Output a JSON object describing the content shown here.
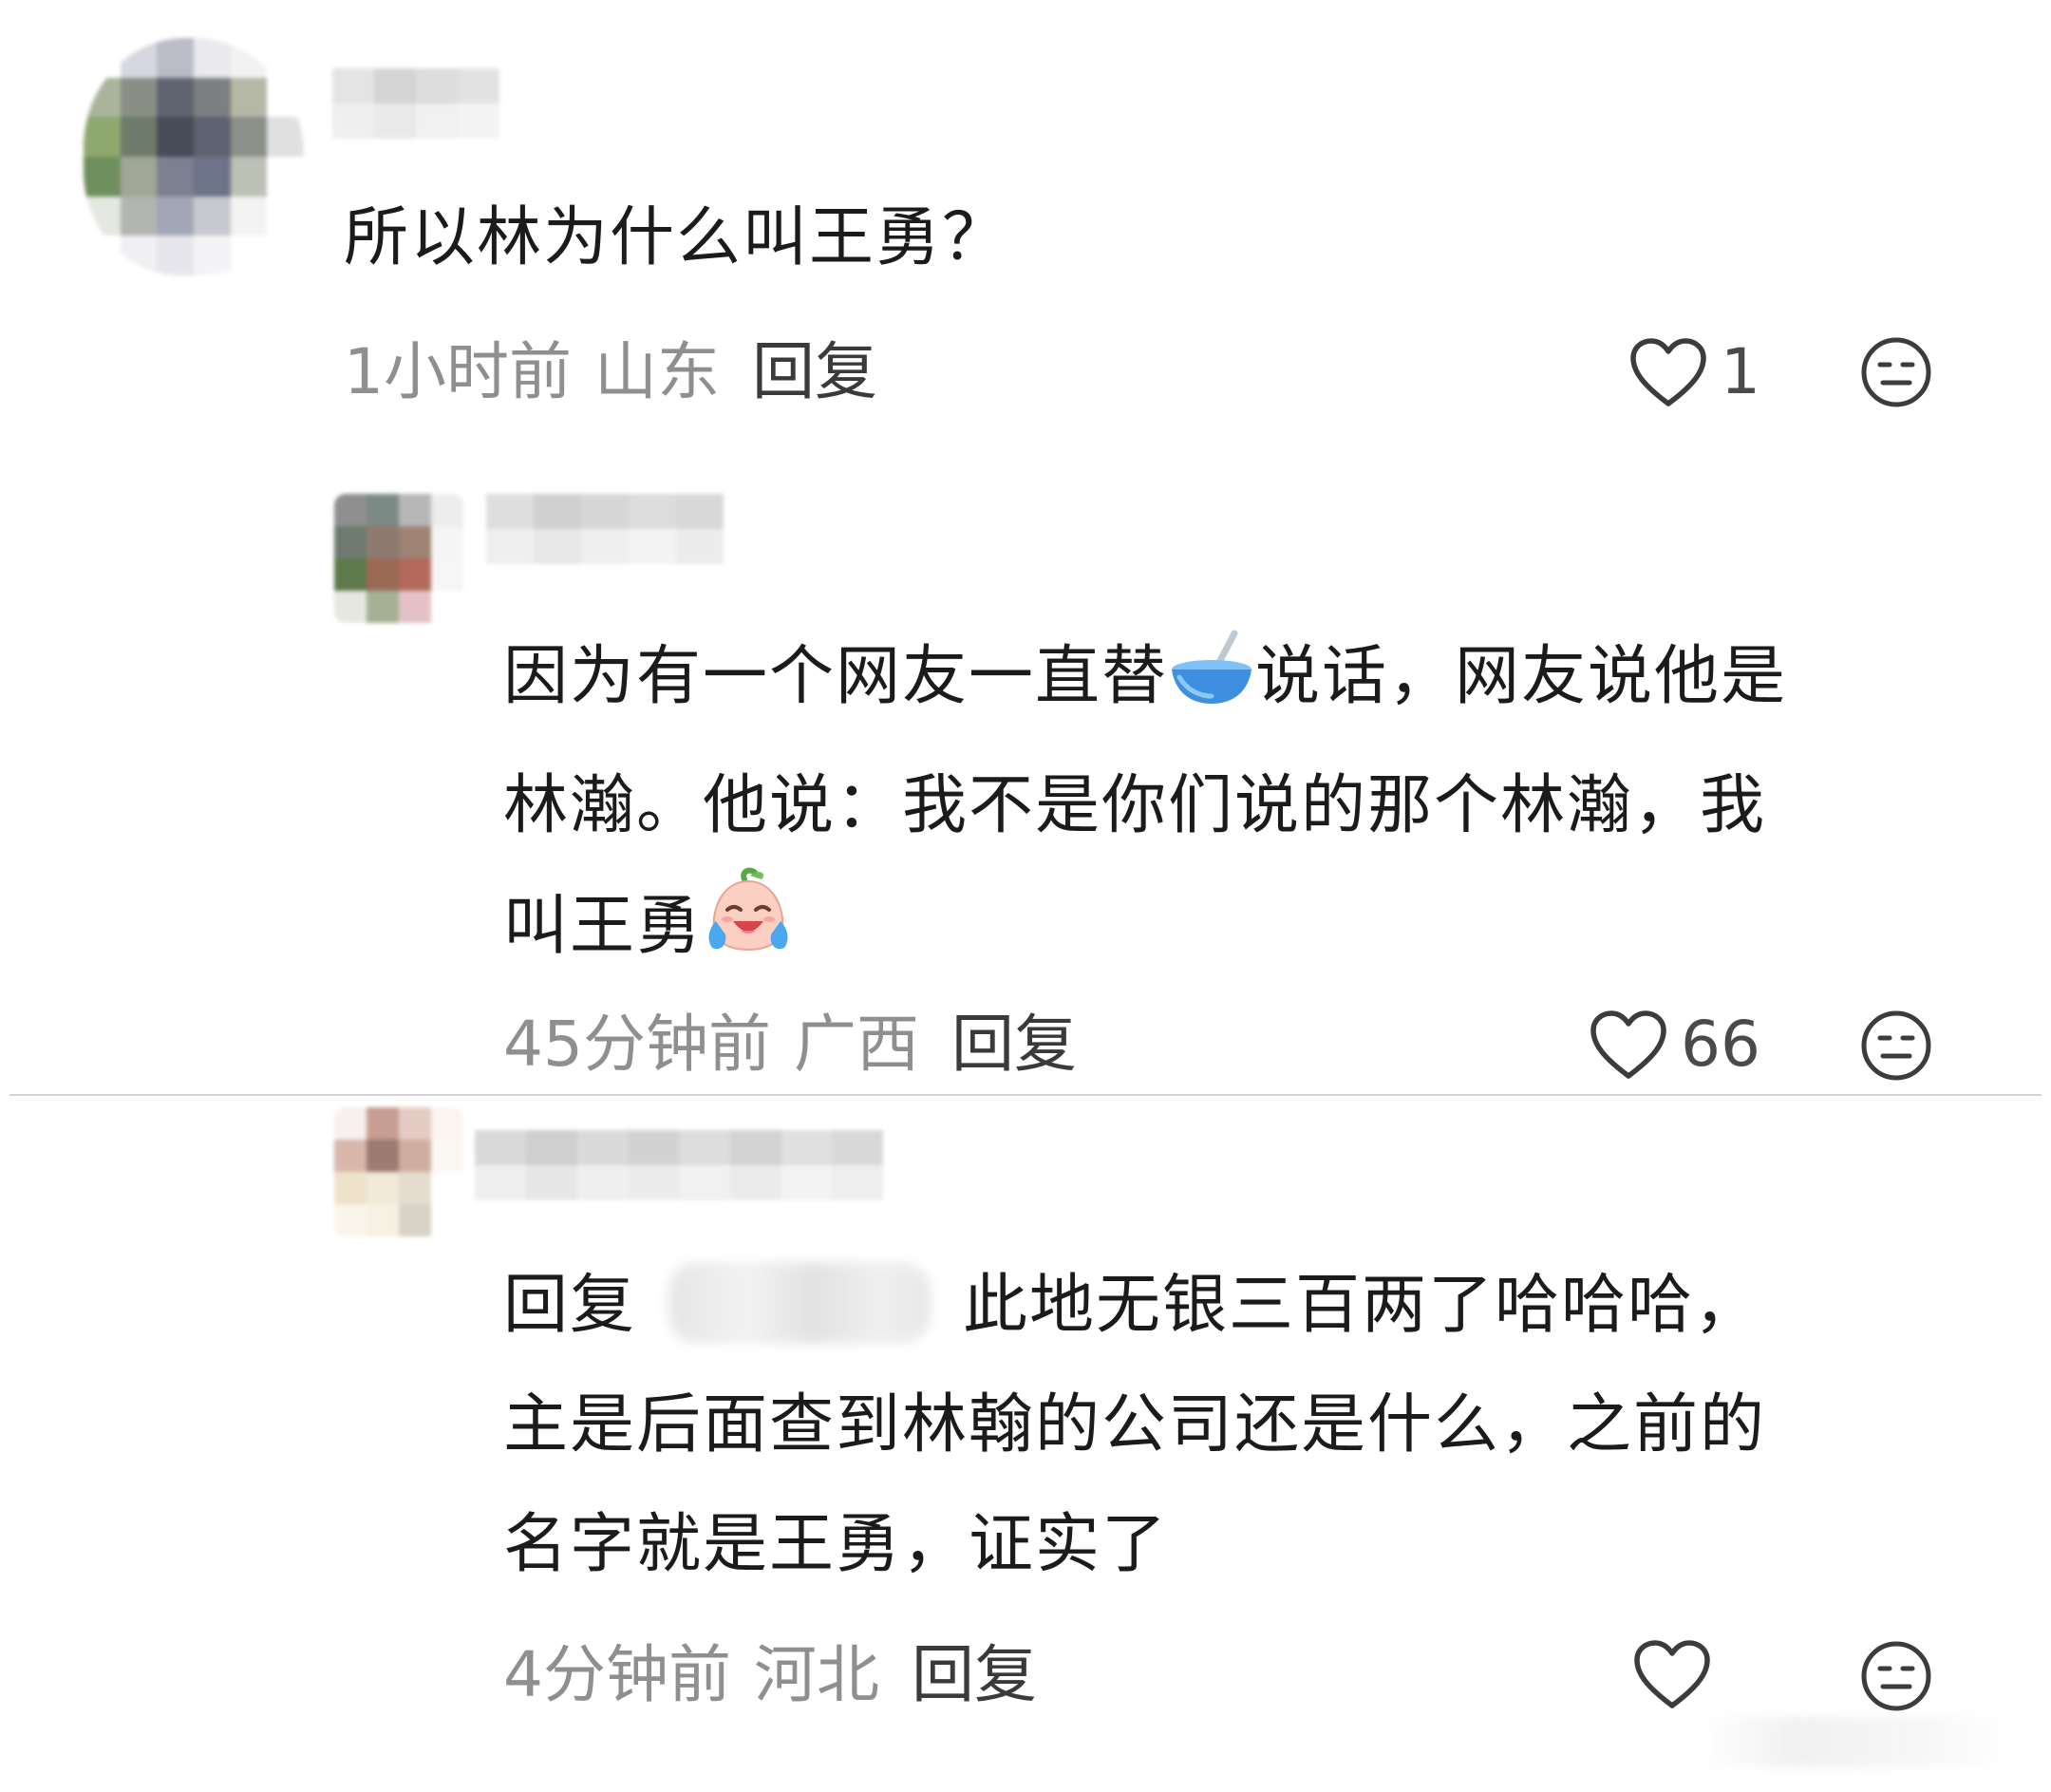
{
  "comments": [
    {
      "text": "所以林为什么叫王勇？",
      "time": "1小时前",
      "location": "山东",
      "reply_label": "回复",
      "likes": "1"
    },
    {
      "text_line1_a": "因为有一个网友一直替",
      "text_line1_b": "说话，网友说他是",
      "text_line2": "林瀚。他说：我不是你们说的那个林瀚，我",
      "text_line3": "叫王勇",
      "time": "45分钟前",
      "location": "广西",
      "reply_label": "回复",
      "likes": "66"
    },
    {
      "reply_prefix": "回复",
      "text_line1": "此地无银三百两了哈哈哈，",
      "text_line2": "主是后面查到林翰的公司还是什么，之前的",
      "text_line3": "名字就是王勇，证实了",
      "time": "4分钟前",
      "location": "河北",
      "reply_label": "回复",
      "likes": ""
    }
  ],
  "icons": {
    "like": "heart-outline-icon",
    "dislike": "neutral-face-icon",
    "emoji_bowl": "bowl-emoji-icon",
    "emoji_cry": "crying-laugh-emoji-icon"
  },
  "colors": {
    "text": "#1b1b1b",
    "meta": "#8f8f8f",
    "reply": "#3a3a3a",
    "divider": "#d3d3d3",
    "bowl": "#3f8fe0"
  }
}
